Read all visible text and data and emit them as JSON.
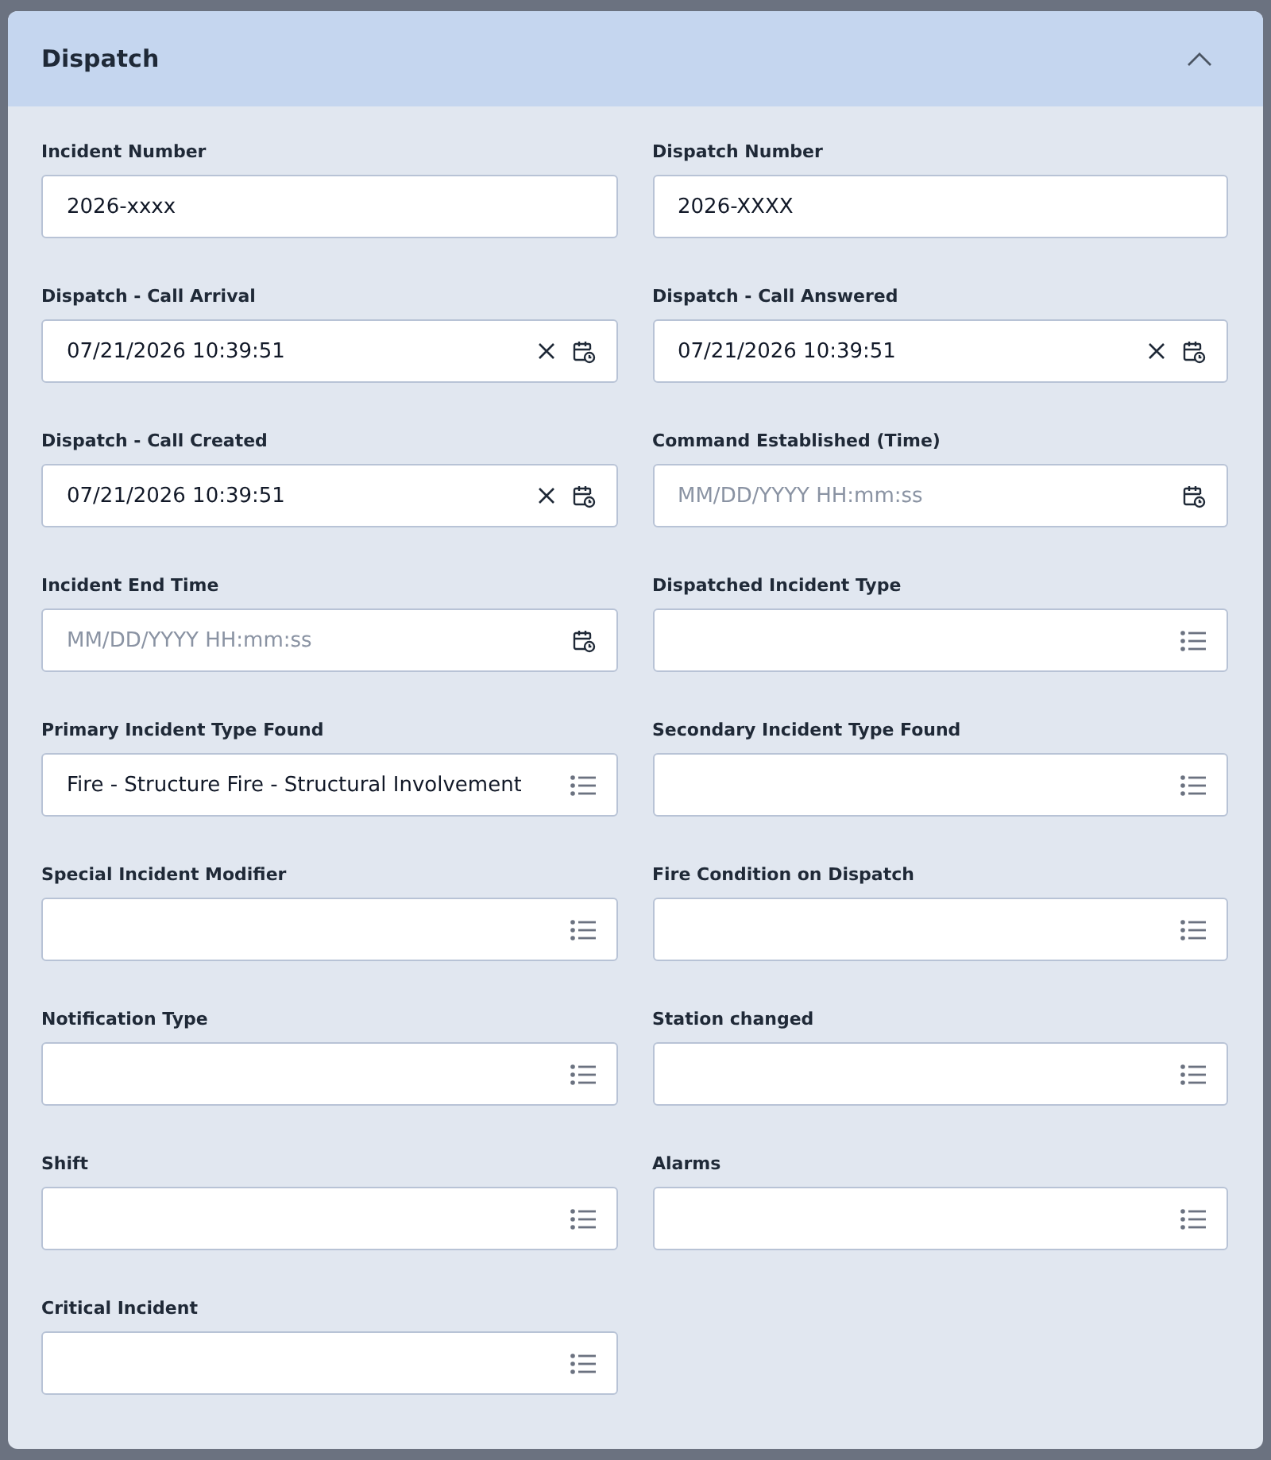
{
  "panel": {
    "title": "Dispatch",
    "expanded": true
  },
  "fields": [
    {
      "label": "Incident Number",
      "kind": "text",
      "value": "2026-xxxx"
    },
    {
      "label": "Dispatch Number",
      "kind": "text",
      "value": "2026-XXXX"
    },
    {
      "label": "Dispatch - Call Arrival",
      "kind": "datetime",
      "value": "07/21/2026 10:39:51"
    },
    {
      "label": "Dispatch - Call Answered",
      "kind": "datetime",
      "value": "07/21/2026 10:39:51"
    },
    {
      "label": "Dispatch - Call Created",
      "kind": "datetime",
      "value": "07/21/2026 10:39:51"
    },
    {
      "label": "Command Established (Time)",
      "kind": "datetime",
      "placeholder": "MM/DD/YYYY HH:mm:ss"
    },
    {
      "label": "Incident End Time",
      "kind": "datetime",
      "placeholder": "MM/DD/YYYY HH:mm:ss"
    },
    {
      "label": "Dispatched Incident Type",
      "kind": "list"
    },
    {
      "label": "Primary Incident Type Found",
      "kind": "list",
      "value": "Fire - Structure Fire - Structural Involvement"
    },
    {
      "label": "Secondary Incident Type Found",
      "kind": "list"
    },
    {
      "label": "Special Incident Modifier",
      "kind": "list"
    },
    {
      "label": "Fire Condition on Dispatch",
      "kind": "list"
    },
    {
      "label": "Notification Type",
      "kind": "list"
    },
    {
      "label": "Station changed",
      "kind": "list"
    },
    {
      "label": "Shift",
      "kind": "list"
    },
    {
      "label": "Alarms",
      "kind": "list"
    },
    {
      "label": "Critical Incident",
      "kind": "list"
    }
  ]
}
